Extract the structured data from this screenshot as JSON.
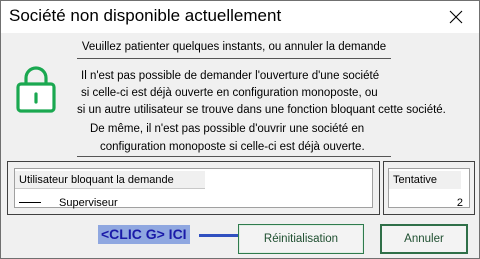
{
  "window": {
    "title": "Société non disponible actuellement"
  },
  "content": {
    "heading": "Veuillez patienter quelques instants, ou annuler la demande",
    "message_lines": [
      "Il n'est pas possible de demander l'ouverture d'une société",
      "si celle-ci est déjà ouverte en configuration monoposte, ou",
      "si un autre utilisateur se trouve dans une fonction bloquant  cette société.",
      "De même, il n'est pas possible d'ouvrir une société en",
      "configuration monoposte si celle-ci est déjà ouverte."
    ]
  },
  "table": {
    "user_header": "Utilisateur bloquant la demande",
    "user_value": "Superviseur",
    "try_header": "Tentative",
    "try_value": "2"
  },
  "annotation": {
    "text": "<CLIC G> ICI"
  },
  "buttons": {
    "reset": "Réinitialisation",
    "cancel": "Annuler"
  },
  "icons": {
    "lock": "lock-icon",
    "close": "close-icon"
  },
  "colors": {
    "accent": "#1aa850",
    "hint_bg": "#8fa7e0",
    "hint_text": "#1a1aa8"
  }
}
